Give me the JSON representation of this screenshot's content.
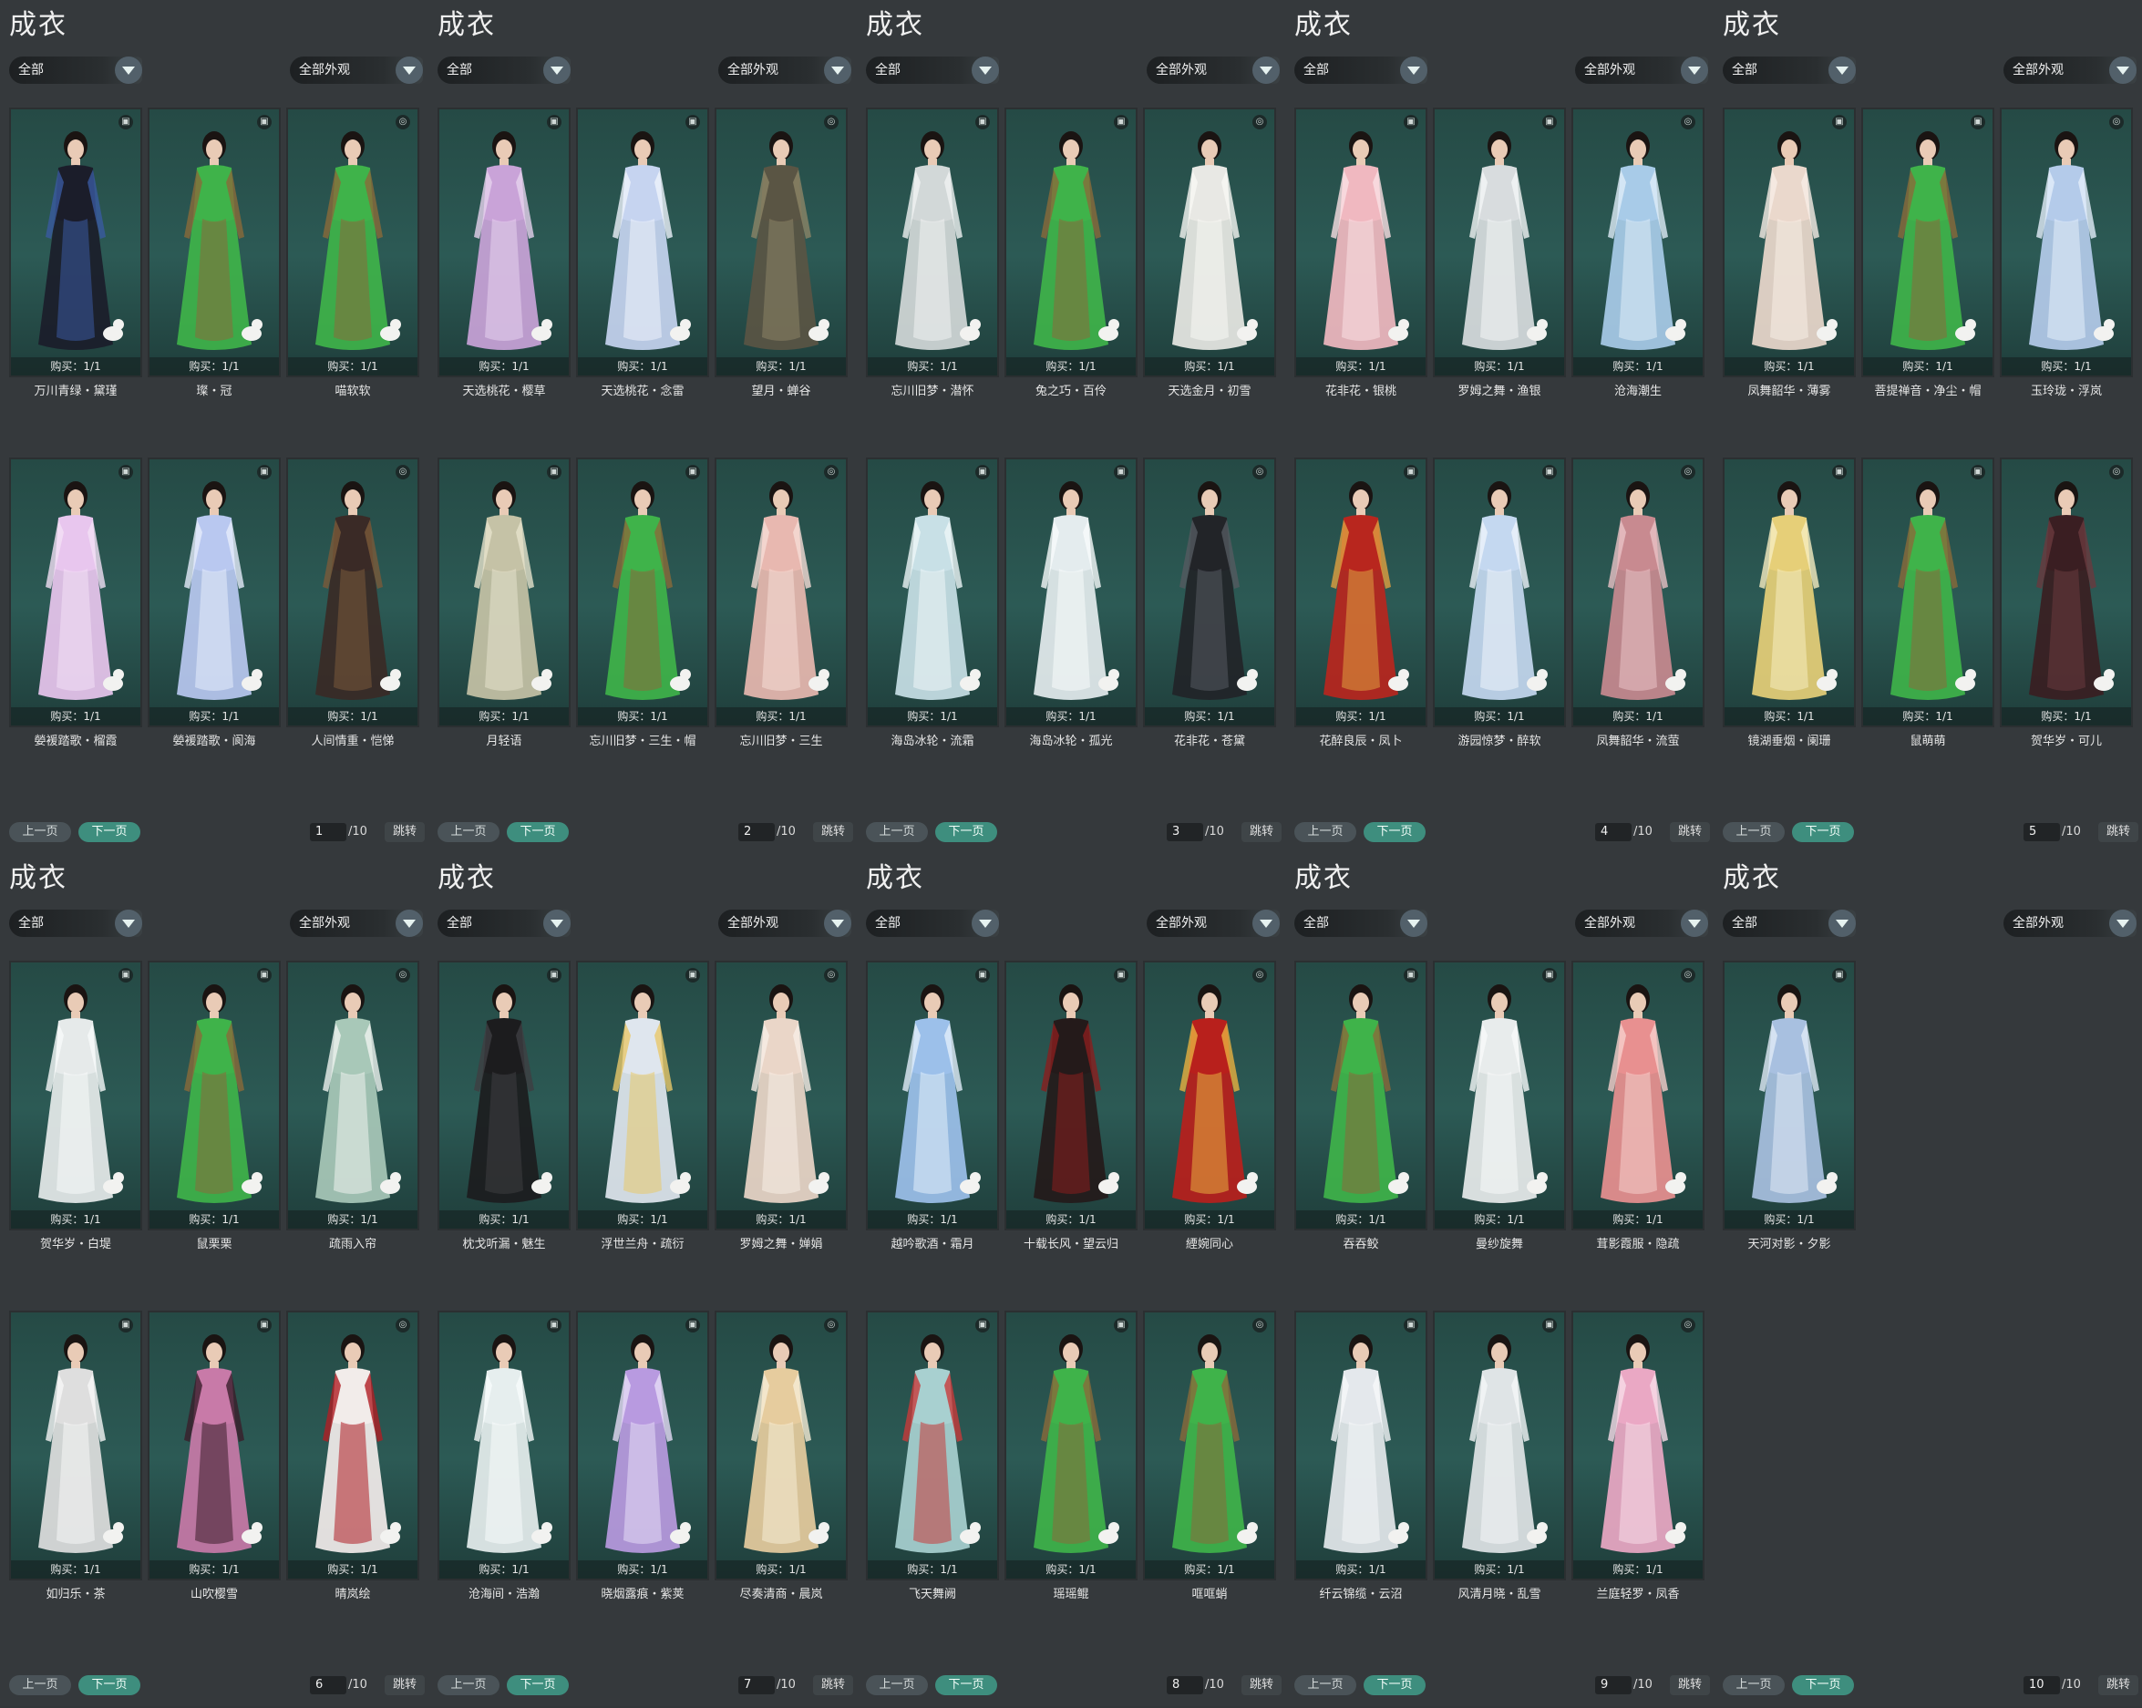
{
  "colors": {
    "background": "#33373a",
    "card": "#2c5a55",
    "next_button": "#3e8e7e"
  },
  "panels": [
    {
      "title": "成衣",
      "filter_left": "全部",
      "filter_right": "全部外观",
      "items": [
        {
          "name": "万川青绿・黛瑾",
          "buy": "购买：1/1",
          "dress": "#1b1d2a",
          "accent": "#3a5aa0"
        },
        {
          "name": "璨・冠",
          "buy": "购买：1/1",
          "dress": "#3fb34a",
          "accent": "#8a6a3a"
        },
        {
          "name": "喵软软",
          "buy": "购买：1/1",
          "dress": "#3fb34a",
          "accent": "#8a6a3a"
        },
        {
          "name": "嫈褑踏歌・榴霞",
          "buy": "购买：1/1",
          "dress": "#e8c6ee",
          "accent": "#f2e0f5"
        },
        {
          "name": "嫈褑踏歌・阆海",
          "buy": "购买：1/1",
          "dress": "#b9c8f0",
          "accent": "#e6ecfb"
        },
        {
          "name": "人间情重・恺悌",
          "buy": "购买：1/1",
          "dress": "#3a2a26",
          "accent": "#7a5a3a"
        }
      ],
      "pager": {
        "prev": "上一页",
        "next": "下一页",
        "page": "1",
        "total": "/10",
        "jump": "跳转"
      }
    },
    {
      "title": "成衣",
      "filter_left": "全部",
      "filter_right": "全部外观",
      "items": [
        {
          "name": "天选桃花・樱草",
          "buy": "购买：1/1",
          "dress": "#c9a3d8",
          "accent": "#e6d2ee"
        },
        {
          "name": "天选桃花・念雷",
          "buy": "购买：1/1",
          "dress": "#c6d4f0",
          "accent": "#eef2fb"
        },
        {
          "name": "望月・蝉谷",
          "buy": "购买：1/1",
          "dress": "#5a5544",
          "accent": "#8c8466"
        },
        {
          "name": "月轻语",
          "buy": "购买：1/1",
          "dress": "#c5c2a6",
          "accent": "#e6e2cc"
        },
        {
          "name": "忘川旧梦・三生・帽",
          "buy": "购买：1/1",
          "dress": "#3fb34a",
          "accent": "#8a6a3a"
        },
        {
          "name": "忘川旧梦・三生",
          "buy": "购买：1/1",
          "dress": "#e8b8b0",
          "accent": "#f5dcd6"
        }
      ],
      "pager": {
        "prev": "上一页",
        "next": "下一页",
        "page": "2",
        "total": "/10",
        "jump": "跳转"
      }
    },
    {
      "title": "成衣",
      "filter_left": "全部",
      "filter_right": "全部外观",
      "items": [
        {
          "name": "忘川旧梦・潜怀",
          "buy": "购买：1/1",
          "dress": "#d2d8d8",
          "accent": "#f0f2f2"
        },
        {
          "name": "兔之巧・百伶",
          "buy": "购买：1/1",
          "dress": "#3fb34a",
          "accent": "#8a6a3a"
        },
        {
          "name": "天选金月・初雪",
          "buy": "购买：1/1",
          "dress": "#e8e8e4",
          "accent": "#f8f8f4"
        },
        {
          "name": "海岛冰轮・流霜",
          "buy": "购买：1/1",
          "dress": "#c8e0e6",
          "accent": "#eef6f8"
        },
        {
          "name": "海岛冰轮・孤光",
          "buy": "购买：1/1",
          "dress": "#e4ecee",
          "accent": "#f8fbfb"
        },
        {
          "name": "花非花・苍黛",
          "buy": "购买：1/1",
          "dress": "#222428",
          "accent": "#555a60"
        }
      ],
      "pager": {
        "prev": "上一页",
        "next": "下一页",
        "page": "3",
        "total": "/10",
        "jump": "跳转"
      }
    },
    {
      "title": "成衣",
      "filter_left": "全部",
      "filter_right": "全部外观",
      "items": [
        {
          "name": "花非花・银桃",
          "buy": "购买：1/1",
          "dress": "#f0b8c0",
          "accent": "#fae0e4"
        },
        {
          "name": "罗姆之舞・渔银",
          "buy": "购买：1/1",
          "dress": "#d8dcde",
          "accent": "#f4f6f6"
        },
        {
          "name": "沧海潮生",
          "buy": "购买：1/1",
          "dress": "#a8cbe8",
          "accent": "#deecf8"
        },
        {
          "name": "花醉良辰・凤卜",
          "buy": "购买：1/1",
          "dress": "#b8261e",
          "accent": "#e0a040"
        },
        {
          "name": "游园惊梦・醉软",
          "buy": "购买：1/1",
          "dress": "#c4d8f0",
          "accent": "#eef4fb"
        },
        {
          "name": "凤舞韶华・流萤",
          "buy": "购买：1/1",
          "dress": "#c88a90",
          "accent": "#eac2c6"
        }
      ],
      "pager": {
        "prev": "上一页",
        "next": "下一页",
        "page": "4",
        "total": "/10",
        "jump": "跳转"
      }
    },
    {
      "title": "成衣",
      "filter_left": "全部",
      "filter_right": "全部外观",
      "items": [
        {
          "name": "凤舞韶华・薄雾",
          "buy": "购买：1/1",
          "dress": "#ead8cc",
          "accent": "#f8eee6"
        },
        {
          "name": "菩提禅音・净尘・帽",
          "buy": "购买：1/1",
          "dress": "#3fb34a",
          "accent": "#8a6a3a"
        },
        {
          "name": "玉玲珑・浮岚",
          "buy": "购买：1/1",
          "dress": "#b4cbea",
          "accent": "#e4eefa"
        },
        {
          "name": "镜湖垂烟・阑珊",
          "buy": "购买：1/1",
          "dress": "#e6cf78",
          "accent": "#f6ecc0"
        },
        {
          "name": "鼠萌萌",
          "buy": "购买：1/1",
          "dress": "#3fb34a",
          "accent": "#8a6a3a"
        },
        {
          "name": "贺华岁・可儿",
          "buy": "购买：1/1",
          "dress": "#3a1e22",
          "accent": "#6a3a3e"
        }
      ],
      "pager": {
        "prev": "上一页",
        "next": "下一页",
        "page": "5",
        "total": "/10",
        "jump": "跳转"
      }
    },
    {
      "title": "成衣",
      "filter_left": "全部",
      "filter_right": "全部外观",
      "items": [
        {
          "name": "贺华岁・白堤",
          "buy": "购买：1/1",
          "dress": "#e6eaea",
          "accent": "#f8fafa"
        },
        {
          "name": "鼠栗栗",
          "buy": "购买：1/1",
          "dress": "#3fb34a",
          "accent": "#8a6a3a"
        },
        {
          "name": "疏雨入帘",
          "buy": "购买：1/1",
          "dress": "#a8c8b8",
          "accent": "#eef2ef"
        },
        {
          "name": "如归乐・茶",
          "buy": "购买：1/1",
          "dress": "#dedede",
          "accent": "#f6f6f6"
        },
        {
          "name": "山吹樱雪",
          "buy": "购买：1/1",
          "dress": "#c87aa8",
          "accent": "#3a1e2a"
        },
        {
          "name": "晴岚绘",
          "buy": "购买：1/1",
          "dress": "#f2ecea",
          "accent": "#b01e24"
        }
      ],
      "pager": {
        "prev": "上一页",
        "next": "下一页",
        "page": "6",
        "total": "/10",
        "jump": "跳转"
      }
    },
    {
      "title": "成衣",
      "filter_left": "全部",
      "filter_right": "全部外观",
      "items": [
        {
          "name": "枕戈听漏・魅生",
          "buy": "购买：1/1",
          "dress": "#1c1c1e",
          "accent": "#3e3e42"
        },
        {
          "name": "浮世兰舟・疏衍",
          "buy": "购买：1/1",
          "dress": "#dfe6ee",
          "accent": "#e8c86a"
        },
        {
          "name": "罗姆之舞・婵娟",
          "buy": "购买：1/1",
          "dress": "#ead6c8",
          "accent": "#f8eee6"
        },
        {
          "name": "沧海间・浩瀚",
          "buy": "购买：1/1",
          "dress": "#e6eeee",
          "accent": "#f8fbfb"
        },
        {
          "name": "晓烟露痕・紫荚",
          "buy": "购买：1/1",
          "dress": "#b89ae0",
          "accent": "#e6dcf6"
        },
        {
          "name": "尽奏清商・晨岚",
          "buy": "购买：1/1",
          "dress": "#e6cc9e",
          "accent": "#f6ecd6"
        }
      ],
      "pager": {
        "prev": "上一页",
        "next": "下一页",
        "page": "7",
        "total": "/10",
        "jump": "跳转"
      }
    },
    {
      "title": "成衣",
      "filter_left": "全部",
      "filter_right": "全部外观",
      "items": [
        {
          "name": "越吟歌酒・霜月",
          "buy": "购买：1/1",
          "dress": "#9cc0ea",
          "accent": "#e2eefa"
        },
        {
          "name": "十载长风・望云归",
          "buy": "购买：1/1",
          "dress": "#241a1a",
          "accent": "#8a1e1e"
        },
        {
          "name": "緸婉同心",
          "buy": "购买：1/1",
          "dress": "#b8201c",
          "accent": "#e8b040"
        },
        {
          "name": "飞天舞阙",
          "buy": "购买：1/1",
          "dress": "#a8d0d0",
          "accent": "#c83a3a"
        },
        {
          "name": "瑶瑶鲲",
          "buy": "购买：1/1",
          "dress": "#3fb34a",
          "accent": "#8a6a3a"
        },
        {
          "name": "哐哐蛸",
          "buy": "购买：1/1",
          "dress": "#3fb34a",
          "accent": "#8a6a3a"
        }
      ],
      "pager": {
        "prev": "上一页",
        "next": "下一页",
        "page": "8",
        "total": "/10",
        "jump": "跳转"
      }
    },
    {
      "title": "成衣",
      "filter_left": "全部",
      "filter_right": "全部外观",
      "items": [
        {
          "name": "吞吞鲛",
          "buy": "购买：1/1",
          "dress": "#3fb34a",
          "accent": "#8a6a3a"
        },
        {
          "name": "曼纱旋舞",
          "buy": "购买：1/1",
          "dress": "#e8ecec",
          "accent": "#f8fafa"
        },
        {
          "name": "茸影霞服・隐疏",
          "buy": "购买：1/1",
          "dress": "#e89090",
          "accent": "#f6d0cc"
        },
        {
          "name": "纤云锦缆・云沼",
          "buy": "购买：1/1",
          "dress": "#e4e8ec",
          "accent": "#f6f8fa"
        },
        {
          "name": "风清月晓・乱雪",
          "buy": "购买：1/1",
          "dress": "#dfe4e6",
          "accent": "#f4f6f7"
        },
        {
          "name": "兰庭轻罗・凤香",
          "buy": "购买：1/1",
          "dress": "#eaa8c4",
          "accent": "#f8dce8"
        }
      ],
      "pager": {
        "prev": "上一页",
        "next": "下一页",
        "page": "9",
        "total": "/10",
        "jump": "跳转"
      }
    },
    {
      "title": "成衣",
      "filter_left": "全部",
      "filter_right": "全部外观",
      "items": [
        {
          "name": "天河对影・夕影",
          "buy": "购买：1/1",
          "dress": "#a8c0e0",
          "accent": "#e0eaf6"
        }
      ],
      "pager": {
        "prev": "上一页",
        "next": "下一页",
        "page": "10",
        "total": "/10",
        "jump": "跳转"
      }
    }
  ]
}
